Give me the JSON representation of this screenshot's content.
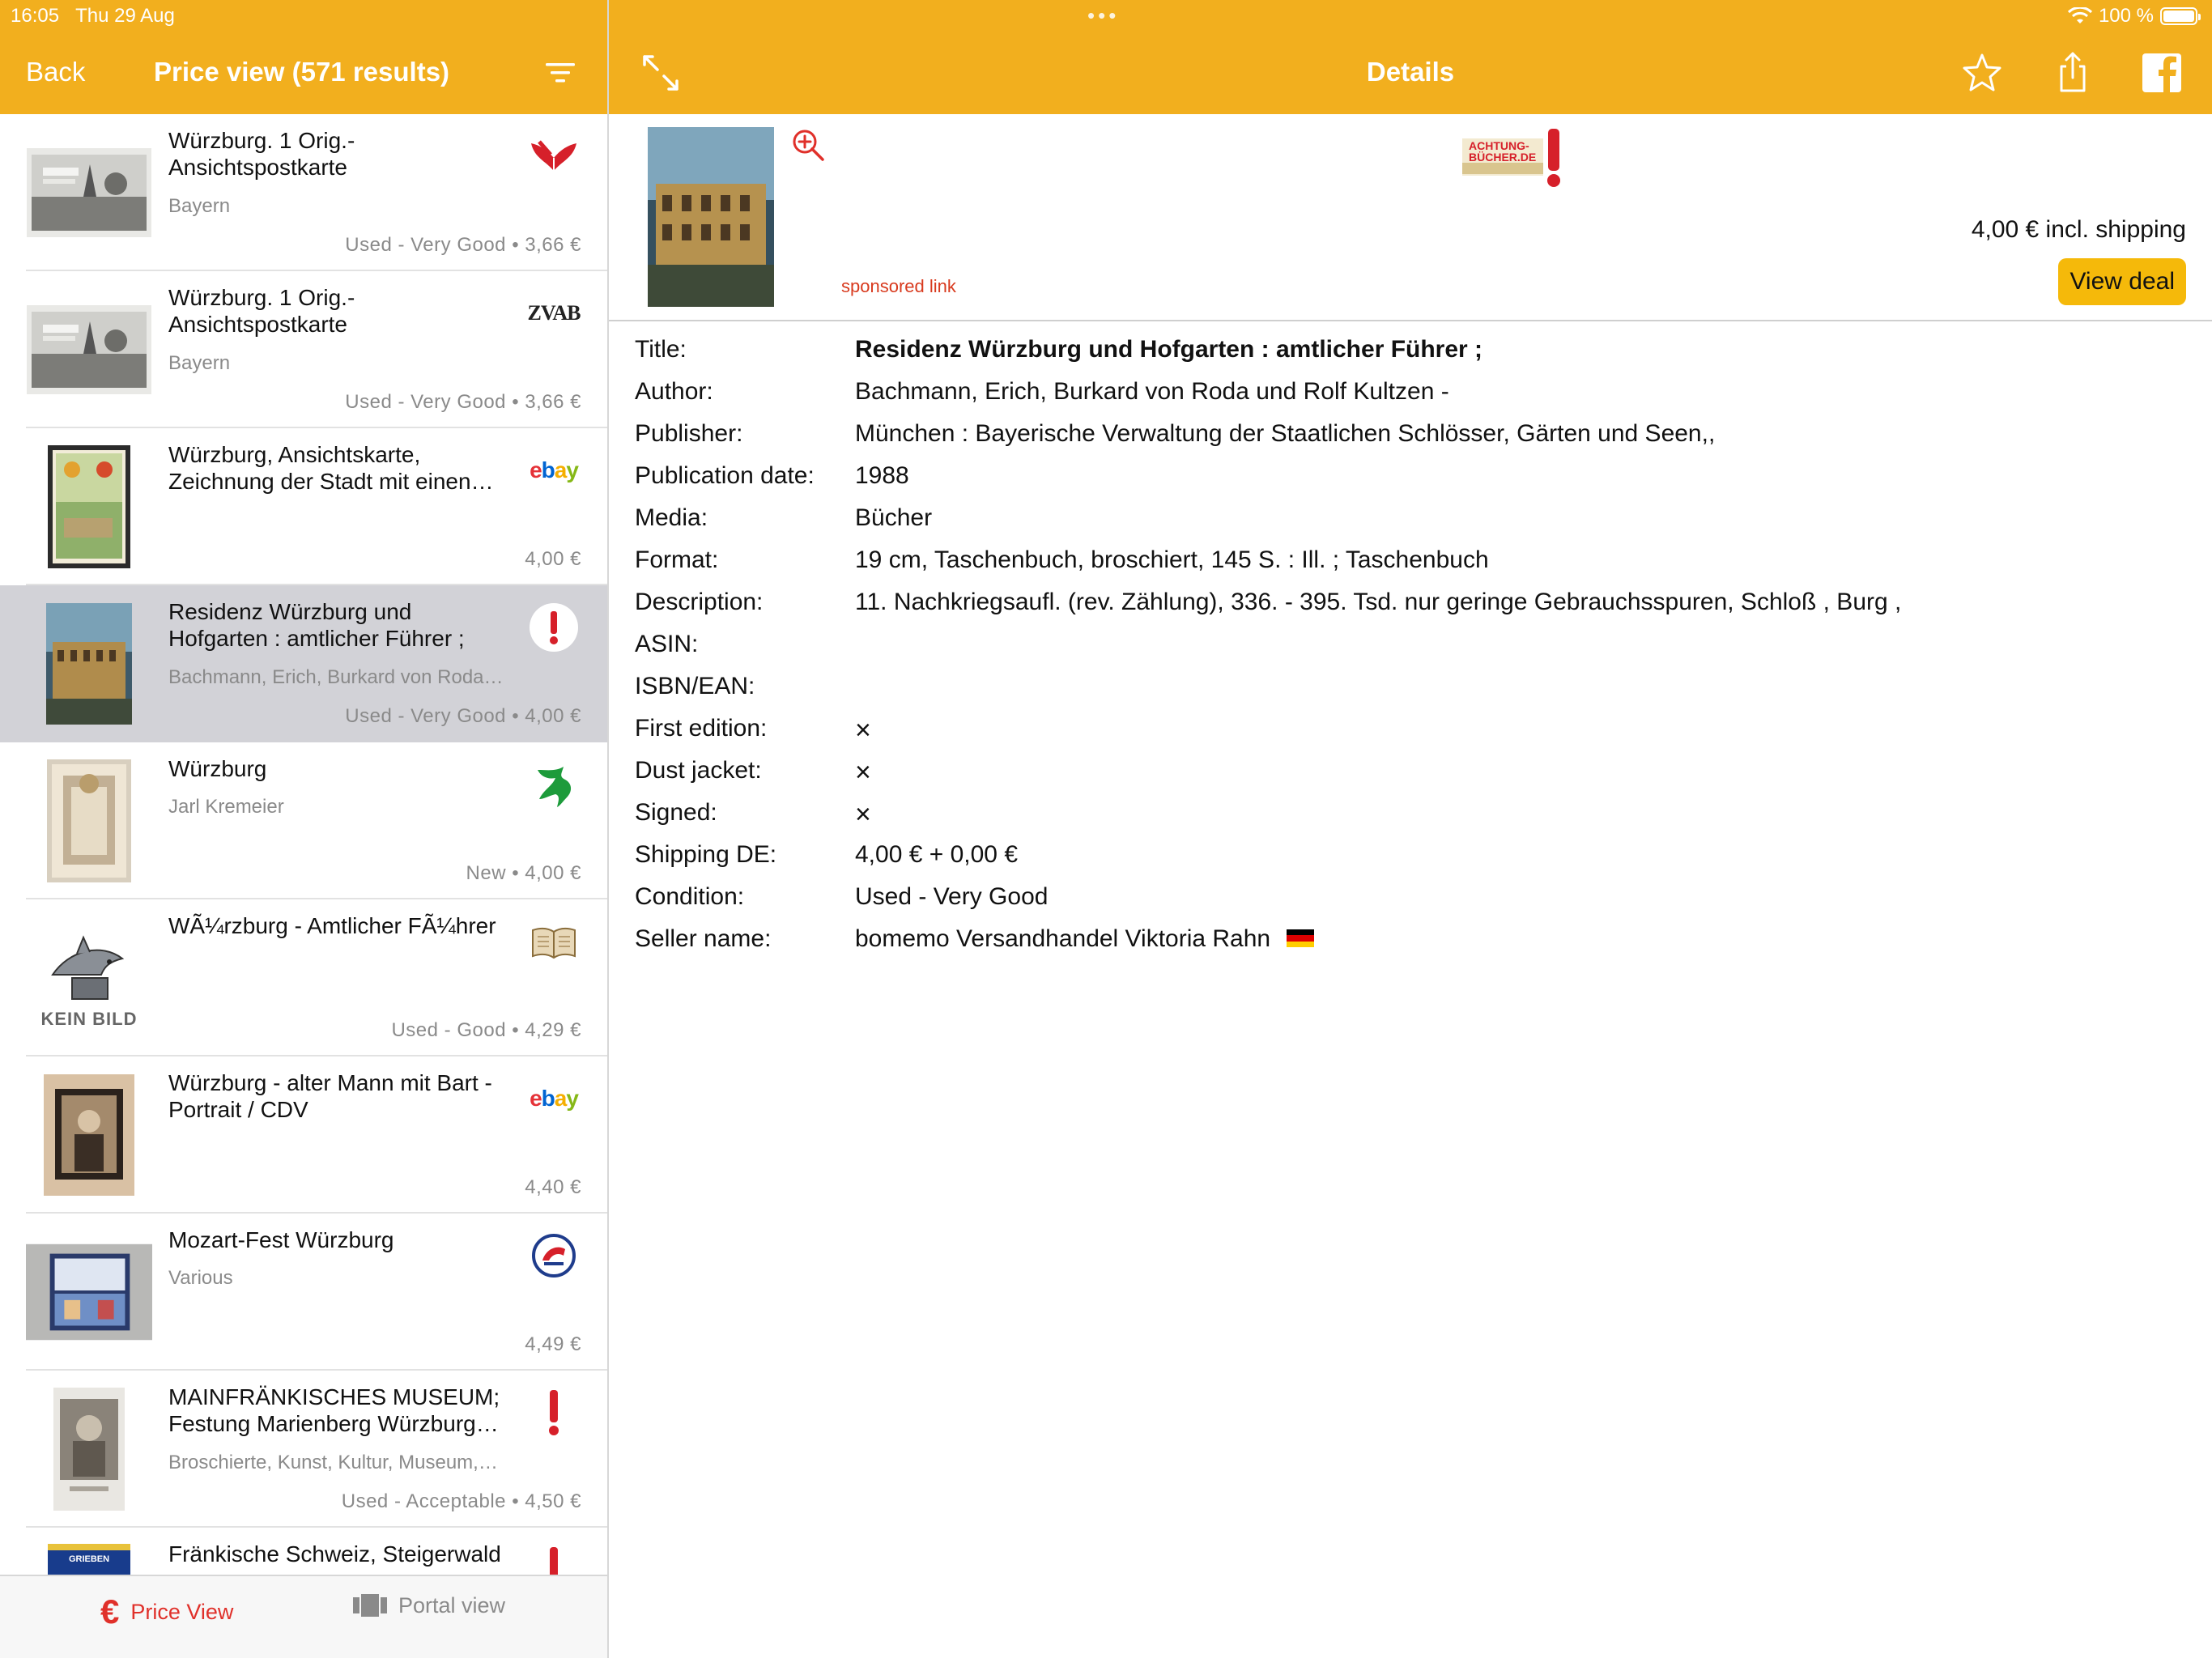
{
  "status": {
    "time": "16:05",
    "date": "Thu 29 Aug",
    "battery": "100 %"
  },
  "nav": {
    "back_label": "Back",
    "list_title": "Price view (571 results)",
    "detail_title": "Details"
  },
  "list": {
    "rows": [
      {
        "title": "Würzburg. 1 Orig.-Ansichtspostkarte",
        "sub": "Bayern",
        "price": "Used - Very Good • 3,66 €",
        "portal": "booklooker-icon"
      },
      {
        "title": "Würzburg. 1 Orig.-Ansichtspostkarte",
        "sub": "Bayern",
        "price": "Used - Very Good • 3,66 €",
        "portal": "zvab-icon",
        "portal_text": "ZVAB"
      },
      {
        "title": "Würzburg, Ansichtskarte, Zeichnung der Stadt mit einen…",
        "sub": "",
        "price": "4,00 €",
        "portal": "ebay-icon",
        "portal_text": "ebay"
      },
      {
        "title": "Residenz Würzburg und Hofgarten : amtlicher Führer ;",
        "sub": "Bachmann, Erich, Burkard von Roda…",
        "price": "Used - Very Good • 4,00 €",
        "portal": "achtung-buecher-icon",
        "selected": true
      },
      {
        "title": "Würzburg",
        "sub": "Jarl Kremeier",
        "price": "New • 4,00 €",
        "portal": "medimops-icon"
      },
      {
        "title": "WÃ¼rzburg - Amtlicher FÃ¼hrer",
        "sub": "",
        "price": "Used - Good • 4,29 €",
        "portal": "open-book-icon",
        "thumb_text": "KEIN BILD"
      },
      {
        "title": "Würzburg - alter Mann mit Bart - Portrait / CDV",
        "sub": "",
        "price": "4,40 €",
        "portal": "ebay-icon",
        "portal_text": "ebay"
      },
      {
        "title": "Mozart-Fest Würzburg",
        "sub": "Various",
        "price": "4,49 €",
        "portal": "rebuy-icon"
      },
      {
        "title": "MAINFRÄNKISCHES MUSEUM; Festung Marienberg Würzburg…",
        "sub": "Broschierte, Kunst, Kultur, Museum,…",
        "price": "Used - Acceptable • 4,50 €",
        "portal": "exclamation-icon"
      },
      {
        "title": "Fränkische Schweiz, Steigerwald",
        "sub": "",
        "price": "",
        "portal": "exclamation-icon",
        "thumb_text": "GRIEBEN"
      }
    ]
  },
  "tabs": {
    "price_view": "Price View",
    "portal_view": "Portal view"
  },
  "detail": {
    "seller_logo_text": "ACHTUNG-BÜCHER.DE",
    "sponsored": "sponsored link",
    "price_line": "4,00 € incl. shipping",
    "view_deal": "View deal",
    "fields": [
      {
        "label": "Title:",
        "value": "Residenz Würzburg und Hofgarten : amtlicher Führer ;",
        "bold": true
      },
      {
        "label": "Author:",
        "value": "Bachmann, Erich, Burkard von Roda  und Rolf Kultzen -"
      },
      {
        "label": "Publisher:",
        "value": "München : Bayerische Verwaltung der Staatlichen Schlösser, Gärten und Seen,,"
      },
      {
        "label": "Publication date:",
        "value": "1988"
      },
      {
        "label": "Media:",
        "value": "Bücher"
      },
      {
        "label": "Format:",
        "value": "19 cm, Taschenbuch, broschiert,  145 S. : Ill. ; Taschenbuch"
      },
      {
        "label": "Description:",
        "value": "11. Nachkriegsaufl. (rev. Zählung), 336. - 395. Tsd. nur geringe Gebrauchsspuren, Schloß , Burg ,"
      },
      {
        "label": "ASIN:",
        "value": ""
      },
      {
        "label": "ISBN/EAN:",
        "value": ""
      },
      {
        "label": "First edition:",
        "value": "×",
        "xmark": true
      },
      {
        "label": "Dust jacket:",
        "value": "×",
        "xmark": true
      },
      {
        "label": "Signed:",
        "value": "×",
        "xmark": true
      },
      {
        "label": "Shipping DE:",
        "value": "4,00 € + 0,00 €"
      },
      {
        "label": "Condition:",
        "value": "Used - Very Good"
      },
      {
        "label": "Seller name:",
        "value": "bomemo Versandhandel Viktoria Rahn"
      }
    ]
  },
  "colors": {
    "header": "#F2AF1E",
    "accent_red": "#E0302A",
    "view_deal_bg": "#F5B90A",
    "selected_row": "#D2D2D7"
  }
}
